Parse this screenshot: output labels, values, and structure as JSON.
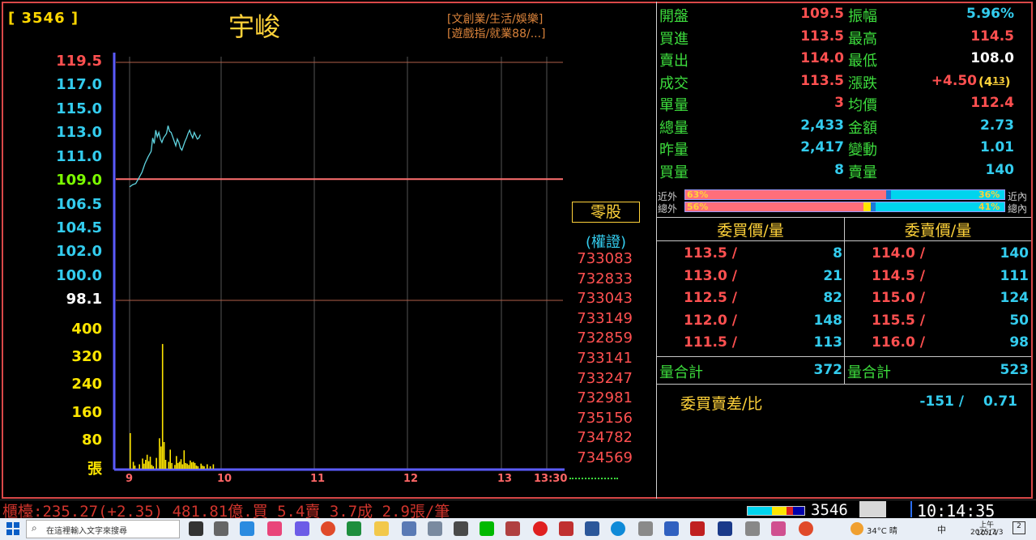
{
  "header": {
    "code": "[ 3546 ]",
    "name": "宇峻",
    "category_line1": "[文創業/生活/娛樂]",
    "category_line2": "[遊戲指/就業88/...]"
  },
  "chart_data": {
    "type": "line",
    "price_ticks": [
      "119.5",
      "117.0",
      "115.0",
      "113.0",
      "111.0",
      "109.0",
      "106.5",
      "104.5",
      "102.0",
      "100.0",
      "98.1"
    ],
    "price_tick_colors": [
      "#ff5050",
      "#33ccee",
      "#33ccee",
      "#33ccee",
      "#33ccee",
      "#7CFC00",
      "#33ccee",
      "#33ccee",
      "#33ccee",
      "#33ccee",
      "#ffffff"
    ],
    "volume_ticks": [
      "400",
      "320",
      "240",
      "160",
      "80"
    ],
    "volume_unit": "張",
    "x_ticks": [
      "9",
      "10",
      "11",
      "12",
      "13",
      "13:30"
    ],
    "ylim": [
      98.1,
      119.5
    ],
    "reference_price": 109.0,
    "volume_ylim": [
      0,
      440
    ],
    "price_series": [
      [
        0,
        108.3
      ],
      [
        2,
        108.5
      ],
      [
        4,
        108.6
      ],
      [
        6,
        109.1
      ],
      [
        8,
        109.6
      ],
      [
        9,
        110.0
      ],
      [
        10,
        110.4
      ],
      [
        12,
        111.0
      ],
      [
        14,
        111.5
      ],
      [
        15,
        112.7
      ],
      [
        16,
        112.2
      ],
      [
        17,
        113.4
      ],
      [
        18,
        112.8
      ],
      [
        19,
        113.2
      ],
      [
        20,
        112.6
      ],
      [
        21,
        112.3
      ],
      [
        22,
        112.7
      ],
      [
        23,
        112.9
      ],
      [
        24,
        113.1
      ],
      [
        25,
        113.8
      ],
      [
        26,
        113.3
      ],
      [
        27,
        113.2
      ],
      [
        28,
        112.8
      ],
      [
        29,
        112.4
      ],
      [
        30,
        112.0
      ],
      [
        31,
        112.6
      ],
      [
        32,
        112.3
      ],
      [
        33,
        111.8
      ],
      [
        34,
        111.6
      ],
      [
        35,
        112.0
      ],
      [
        36,
        112.4
      ],
      [
        37,
        112.7
      ],
      [
        38,
        113.1
      ],
      [
        39,
        113.4
      ],
      [
        40,
        113.0
      ],
      [
        41,
        112.7
      ],
      [
        42,
        113.2
      ],
      [
        43,
        112.9
      ],
      [
        44,
        112.6
      ],
      [
        45,
        112.7
      ],
      [
        46,
        113.0
      ]
    ],
    "volume_series": [
      [
        0,
        112
      ],
      [
        2,
        22
      ],
      [
        3,
        10
      ],
      [
        6,
        14
      ],
      [
        8,
        32
      ],
      [
        9,
        16
      ],
      [
        10,
        28
      ],
      [
        11,
        44
      ],
      [
        12,
        24
      ],
      [
        13,
        38
      ],
      [
        14,
        12
      ],
      [
        15,
        8
      ],
      [
        17,
        34
      ],
      [
        19,
        96
      ],
      [
        20,
        70
      ],
      [
        21,
        392
      ],
      [
        22,
        84
      ],
      [
        23,
        28
      ],
      [
        25,
        22
      ],
      [
        26,
        60
      ],
      [
        27,
        18
      ],
      [
        29,
        12
      ],
      [
        30,
        40
      ],
      [
        31,
        18
      ],
      [
        32,
        22
      ],
      [
        33,
        30
      ],
      [
        34,
        14
      ],
      [
        35,
        58
      ],
      [
        36,
        18
      ],
      [
        37,
        16
      ],
      [
        38,
        12
      ],
      [
        39,
        26
      ],
      [
        40,
        20
      ],
      [
        41,
        22
      ],
      [
        42,
        18
      ],
      [
        43,
        10
      ],
      [
        44,
        8
      ],
      [
        46,
        16
      ],
      [
        47,
        10
      ],
      [
        48,
        8
      ],
      [
        50,
        14
      ],
      [
        52,
        8
      ],
      [
        54,
        14
      ]
    ]
  },
  "odd_lot": {
    "label": "零股",
    "warrants_label": "(權證)",
    "warrants": [
      "733083",
      "732833",
      "733043",
      "733149",
      "732859",
      "733141",
      "733247",
      "732981",
      "735156",
      "734782",
      "734569"
    ]
  },
  "quote": {
    "left": [
      {
        "label": "開盤",
        "value": "109.5",
        "color": "#ff5050"
      },
      {
        "label": "買進",
        "value": "113.5",
        "color": "#ff5050"
      },
      {
        "label": "賣出",
        "value": "114.0",
        "color": "#ff5050"
      },
      {
        "label": "成交",
        "value": "113.5",
        "color": "#ff5050"
      },
      {
        "label": "單量",
        "value": "3",
        "color": "#ff5050"
      },
      {
        "label": "總量",
        "value": "2,433",
        "color": "#33ccee"
      },
      {
        "label": "昨量",
        "value": "2,417",
        "color": "#33ccee"
      },
      {
        "label": "買量",
        "value": "8",
        "color": "#33ccee"
      }
    ],
    "right": [
      {
        "label": "振幅",
        "value": "5.96%",
        "color": "#33ccee"
      },
      {
        "label": "最高",
        "value": "114.5",
        "color": "#ff5050"
      },
      {
        "label": "最低",
        "value": "108.0",
        "color": "#ffffff"
      },
      {
        "label": "漲跌",
        "value": "+4.50",
        "color": "#ff5050"
      },
      {
        "label": "均價",
        "value": "112.4",
        "color": "#ff5050"
      },
      {
        "label": "金額",
        "value": "2.73",
        "color": "#33ccee"
      },
      {
        "label": "變動",
        "value": "1.01",
        "color": "#33ccee"
      },
      {
        "label": "賣量",
        "value": "140",
        "color": "#33ccee"
      }
    ],
    "change_pct": "(4",
    "change_pct_small": "13",
    "change_pct_close": ")"
  },
  "ratio": {
    "near_out_label": "近外",
    "near_out": "63%",
    "near_in": "36%",
    "near_in_label": "近內",
    "total_out_label": "總外",
    "total_out": "56%",
    "total_in": "41%",
    "total_in_label": "總內"
  },
  "order_book": {
    "bid_header": "委買價/量",
    "ask_header": "委賣價/量",
    "bids": [
      [
        "113.5 /",
        "8"
      ],
      [
        "113.0 /",
        "21"
      ],
      [
        "112.5 /",
        "82"
      ],
      [
        "112.0 /",
        "148"
      ],
      [
        "111.5 /",
        "113"
      ]
    ],
    "asks": [
      [
        "114.0 /",
        "140"
      ],
      [
        "114.5 /",
        "111"
      ],
      [
        "115.0 /",
        "124"
      ],
      [
        "115.5 /",
        "50"
      ],
      [
        "116.0 /",
        "98"
      ]
    ],
    "bid_total_label": "量合計",
    "bid_total": "372",
    "ask_total_label": "量合計",
    "ask_total": "523",
    "diff_label": "委買賣差/比",
    "diff_value": "-151 /",
    "diff_ratio": "0.71"
  },
  "bottom_bar": {
    "ticker": "櫃檯:235.27(+2.35) 481.81億.買 5.4賣 3.7成 2.9張/筆",
    "stock_code": "3546_",
    "time": "10:14:35"
  },
  "taskbar": {
    "search_placeholder": "在這裡輸入文字來搜尋",
    "weather": "34°C 晴",
    "lang": "中",
    "time": "上午 10:14",
    "date": "2025/7/3",
    "notification_count": "2"
  }
}
